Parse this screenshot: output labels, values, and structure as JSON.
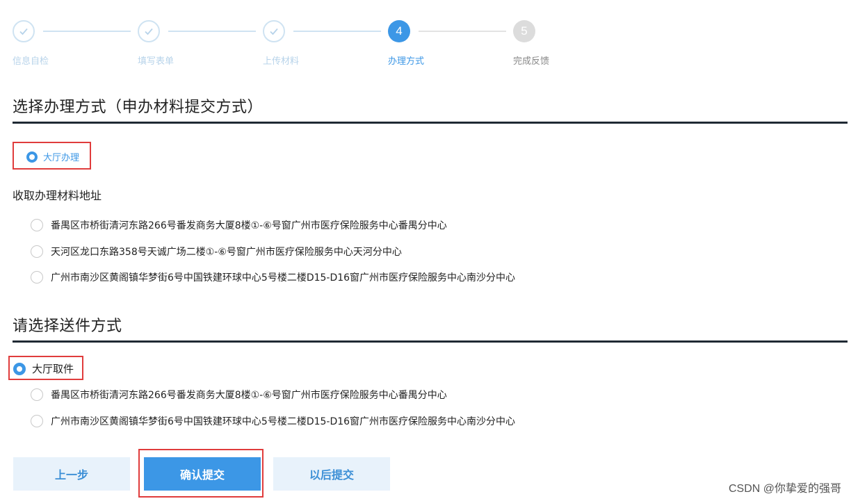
{
  "stepper": {
    "steps": [
      {
        "label": "信息自检",
        "state": "done"
      },
      {
        "label": "填写表单",
        "state": "done"
      },
      {
        "label": "上传材料",
        "state": "done"
      },
      {
        "label": "办理方式",
        "state": "active",
        "number": "4"
      },
      {
        "label": "完成反馈",
        "state": "todo",
        "number": "5"
      }
    ]
  },
  "section1": {
    "title": "选择办理方式（申办材料提交方式）",
    "method_option": "大厅办理",
    "address_heading": "收取办理材料地址",
    "addresses": [
      "番禺区市桥街清河东路266号番发商务大厦8楼①-⑥号窗广州市医疗保险服务中心番禺分中心",
      "天河区龙口东路358号天诚广场二楼①-⑥号窗广州市医疗保险服务中心天河分中心",
      "广州市南沙区黄阁镇华梦街6号中国铁建环球中心5号楼二楼D15-D16窗广州市医疗保险服务中心南沙分中心"
    ]
  },
  "section2": {
    "title": "请选择送件方式",
    "delivery_option": "大厅取件",
    "addresses": [
      "番禺区市桥街清河东路266号番发商务大厦8楼①-⑥号窗广州市医疗保险服务中心番禺分中心",
      "广州市南沙区黄阁镇华梦街6号中国铁建环球中心5号楼二楼D15-D16窗广州市医疗保险服务中心南沙分中心"
    ]
  },
  "buttons": {
    "prev": "上一步",
    "confirm": "确认提交",
    "later": "以后提交"
  },
  "watermark": "CSDN @你挚爱的强哥",
  "colors": {
    "accent": "#3c97e6",
    "highlight": "#e03c3c"
  }
}
